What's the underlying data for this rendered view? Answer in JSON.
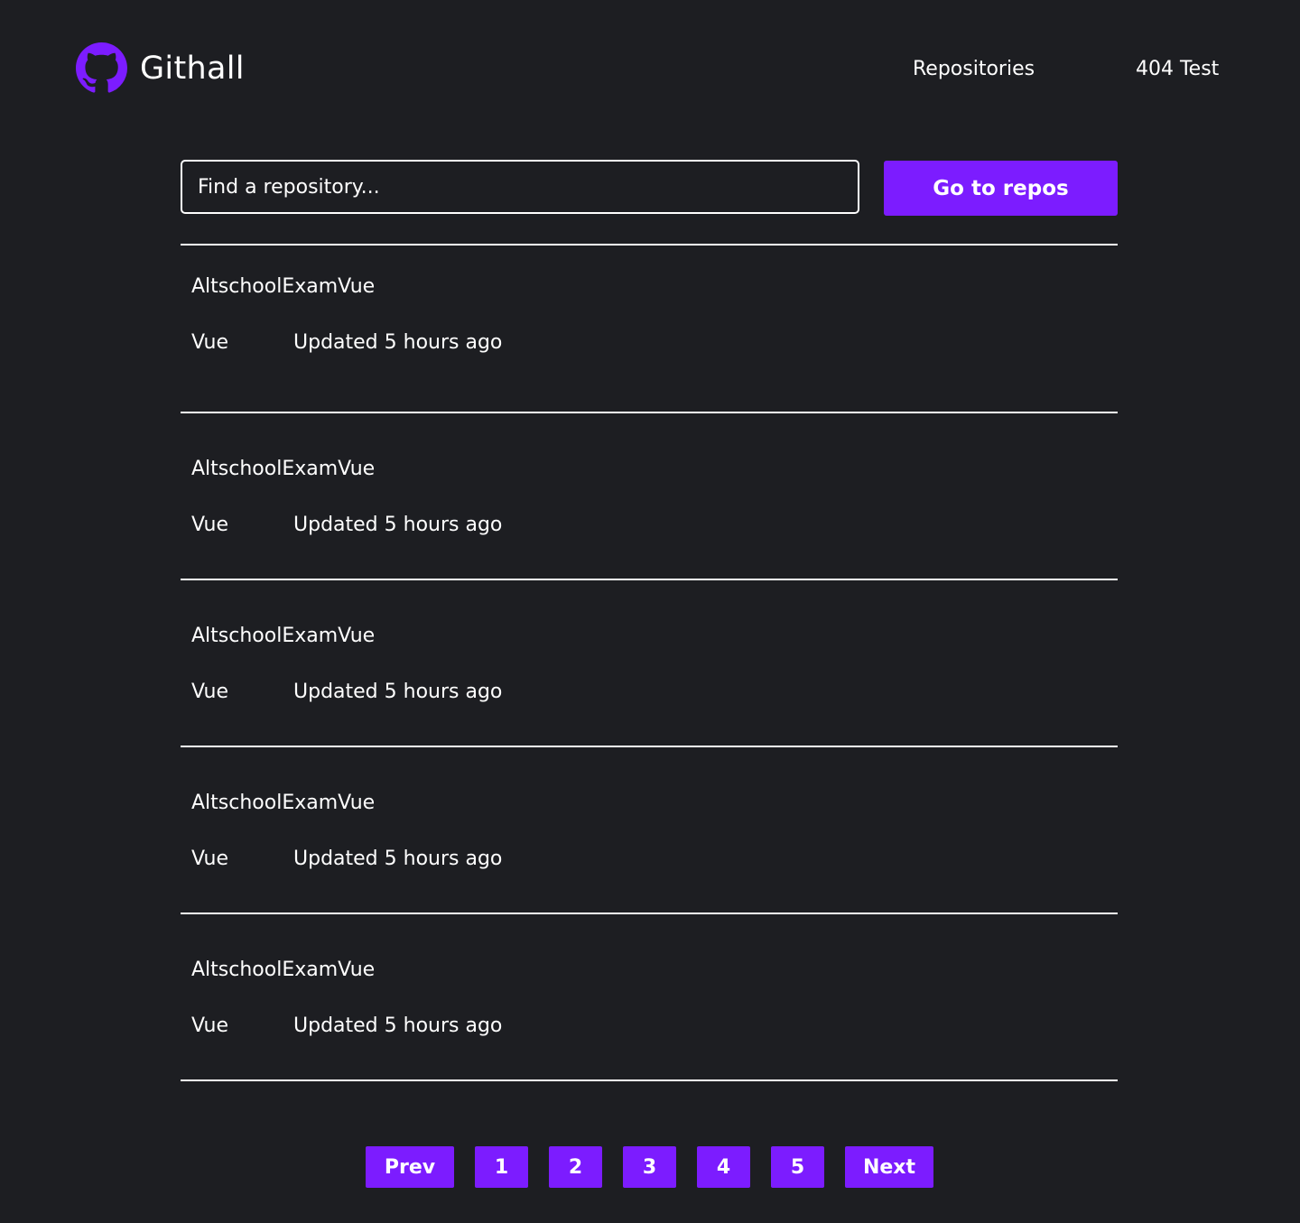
{
  "header": {
    "brand_name": "Githall",
    "logo_icon": "github-octocat-icon",
    "nav": {
      "repositories": "Repositories",
      "not_found_test": "404 Test"
    }
  },
  "search": {
    "placeholder": "Find a repository...",
    "value": "",
    "button_label": "Go to repos"
  },
  "repos": [
    {
      "name": "AltschoolExamVue",
      "language": "Vue",
      "updated": "Updated 5 hours ago"
    },
    {
      "name": "AltschoolExamVue",
      "language": "Vue",
      "updated": "Updated 5 hours ago"
    },
    {
      "name": "AltschoolExamVue",
      "language": "Vue",
      "updated": "Updated 5 hours ago"
    },
    {
      "name": "AltschoolExamVue",
      "language": "Vue",
      "updated": "Updated 5 hours ago"
    },
    {
      "name": "AltschoolExamVue",
      "language": "Vue",
      "updated": "Updated 5 hours ago"
    }
  ],
  "pagination": {
    "prev_label": "Prev",
    "pages": [
      "1",
      "2",
      "3",
      "4",
      "5"
    ],
    "next_label": "Next"
  },
  "colors": {
    "background": "#1d1e22",
    "accent": "#7c1cff",
    "text": "#ffffff"
  }
}
